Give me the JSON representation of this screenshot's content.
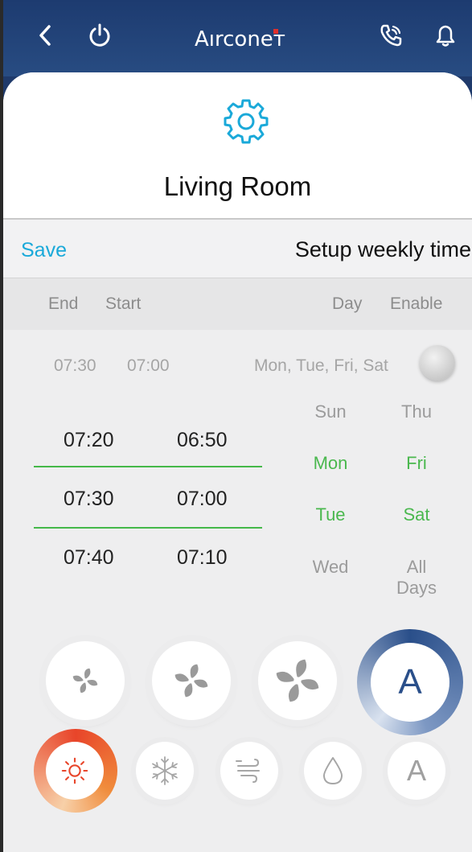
{
  "header": {
    "logo_text": "Aırconeт",
    "back_icon": "back-arrow-icon",
    "power_icon": "power-icon",
    "call_icon": "phone-call-icon",
    "bell_icon": "bell-icon"
  },
  "room": {
    "name": "Living Room",
    "settings_icon": "gear-icon"
  },
  "toolbar": {
    "save_label": "Save",
    "title": "Setup weekly timer"
  },
  "columns": {
    "end": "End",
    "start": "Start",
    "day": "Day",
    "enable": "Enable"
  },
  "existing_timer": {
    "end": "07:30",
    "start": "07:00",
    "days": "Mon, Tue, Fri, Sat",
    "enabled": false
  },
  "picker": {
    "end_values": [
      "07:20",
      "07:30",
      "07:40"
    ],
    "start_values": [
      "06:50",
      "07:00",
      "07:10"
    ],
    "selected_end": "07:30",
    "selected_start": "07:00"
  },
  "days": {
    "left": [
      {
        "label": "Sun",
        "selected": false
      },
      {
        "label": "Mon",
        "selected": true
      },
      {
        "label": "Tue",
        "selected": true
      },
      {
        "label": "Wed",
        "selected": false
      }
    ],
    "right": [
      {
        "label": "Thu",
        "selected": false
      },
      {
        "label": "Fri",
        "selected": true
      },
      {
        "label": "Sat",
        "selected": true
      },
      {
        "label": "All Days",
        "selected": false
      }
    ]
  },
  "fan_speed": {
    "options": [
      "low-fan-icon",
      "medium-fan-icon",
      "high-fan-icon",
      "A"
    ],
    "selected": "A"
  },
  "mode": {
    "options": [
      "sun-heat-icon",
      "snowflake-cool-icon",
      "wind-fan-icon",
      "droplet-dry-icon",
      "A"
    ],
    "selected": "sun-heat-icon"
  },
  "colors": {
    "accent_blue": "#1aa9d9",
    "selected_green": "#4ab84e",
    "header_navy": "#1d3b70",
    "heat_orange": "#e8452a"
  }
}
